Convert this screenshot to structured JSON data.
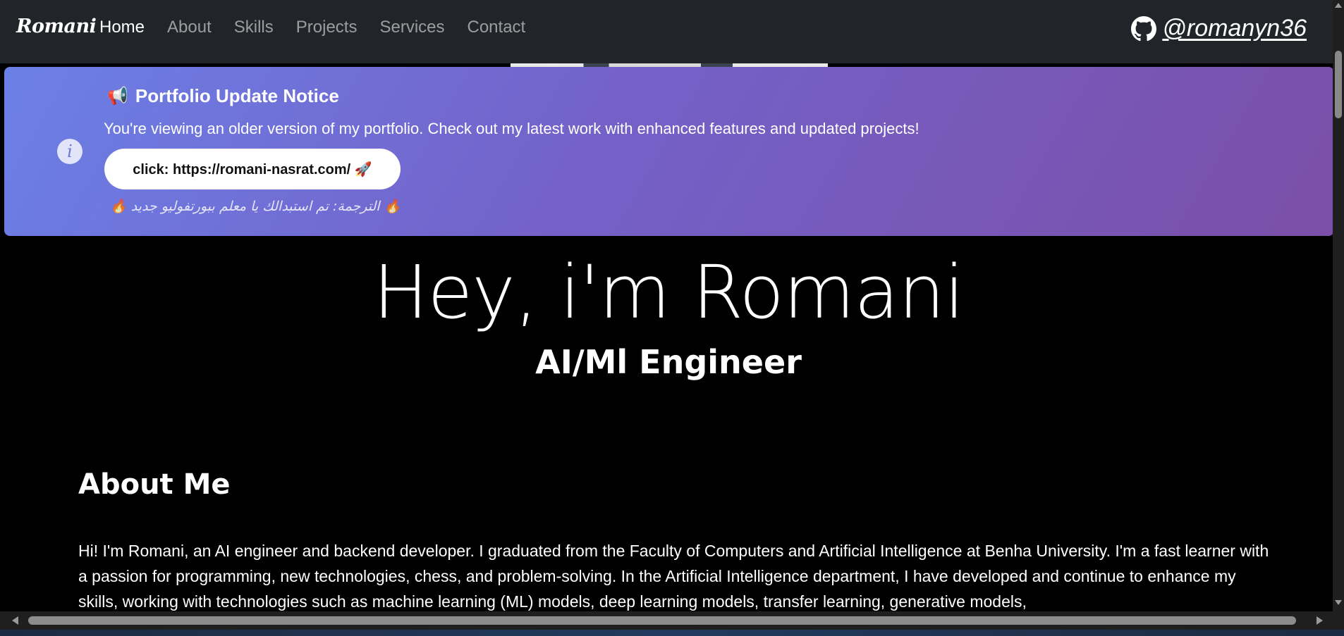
{
  "navbar": {
    "brand": "Romani",
    "links": [
      "Home",
      "About",
      "Skills",
      "Projects",
      "Services",
      "Contact"
    ],
    "active": "Home",
    "github_handle": "@romanyn36"
  },
  "notice": {
    "icon": "megaphone-icon",
    "megaphone_glyph": "📢",
    "title": "Portfolio Update Notice",
    "text": "You're viewing an older version of my portfolio. Check out my latest work with enhanced features and updated projects!",
    "button_label": "click: https://romani-nasrat.com/ 🚀",
    "arabic_note": "🔥 الترجمة: تم استبدالك يا معلم ببورتفوليو جديد 🔥",
    "info_glyph": "i",
    "gradient_start": "#6b80e6",
    "gradient_end": "#7b4fa8"
  },
  "hero": {
    "title": "Hey, i'm Romani",
    "subtitle": "AI/Ml Engineer"
  },
  "about": {
    "heading": "About Me",
    "text": "Hi! I'm Romani, an AI engineer and backend developer. I graduated from the Faculty of Computers and Artificial Intelligence at Benha University. I'm a fast learner with a passion for programming, new technologies, chess, and problem-solving. In the Artificial Intelligence department, I have developed and continue to enhance my skills, working with technologies such as machine learning (ML) models, deep learning models, transfer learning, generative models,"
  },
  "colors": {
    "navbar_bg": "#212529",
    "page_bg": "#000000"
  }
}
